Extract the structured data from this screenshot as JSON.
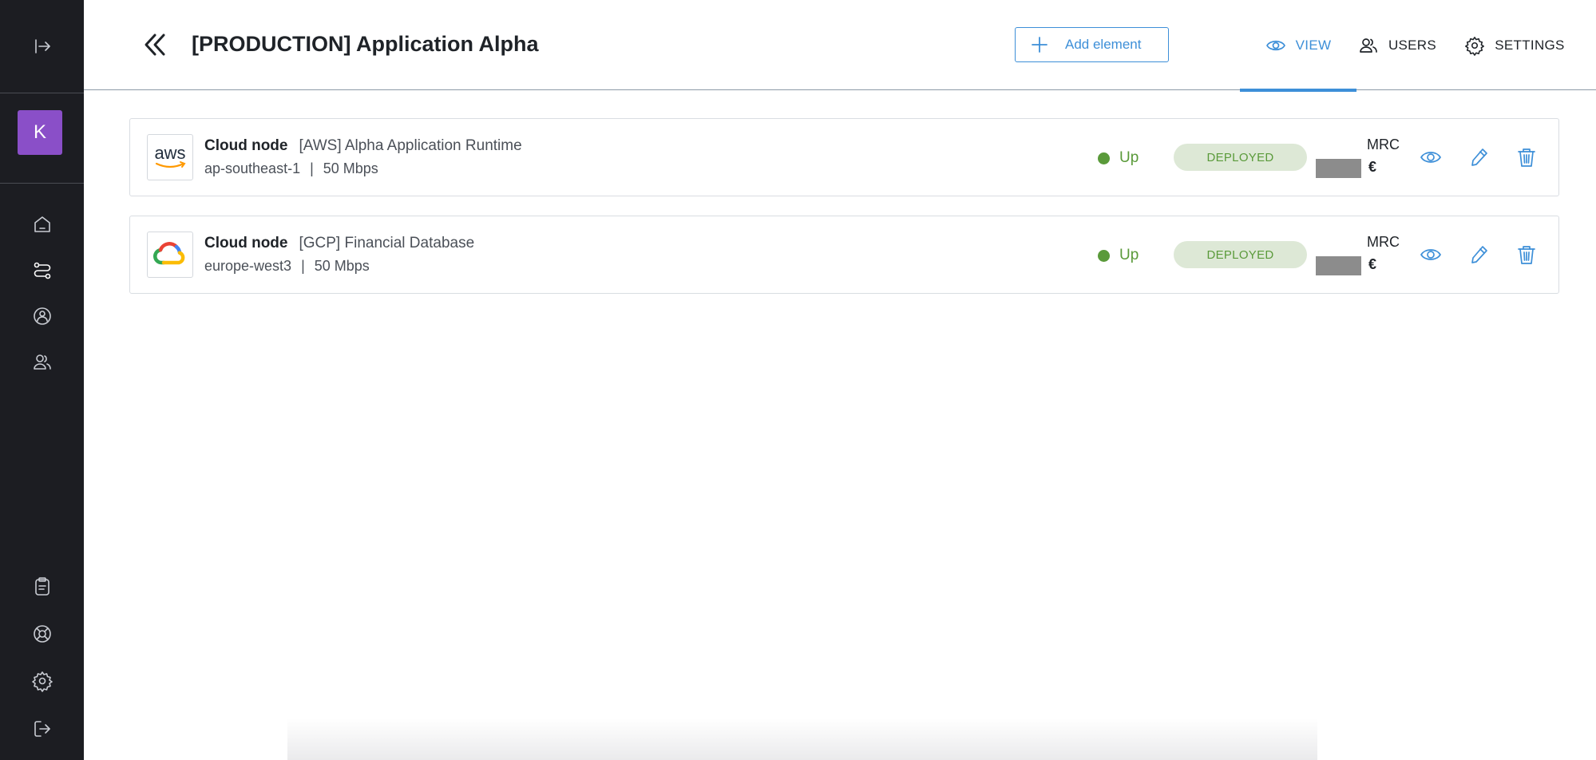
{
  "sidebar": {
    "avatar_letter": "K",
    "top_icons": [
      {
        "icon": "collapse-expand-icon"
      }
    ],
    "nav_icons": [
      {
        "icon": "home-icon"
      },
      {
        "icon": "connections-icon"
      },
      {
        "icon": "network-circle-icon"
      },
      {
        "icon": "users-icon"
      }
    ],
    "bottom_icons": [
      {
        "icon": "clipboard-icon"
      },
      {
        "icon": "support-lifebuoy-icon"
      },
      {
        "icon": "gear-icon"
      },
      {
        "icon": "logout-icon"
      }
    ]
  },
  "header": {
    "title": "[PRODUCTION] Application Alpha",
    "add_button_label": "Add element",
    "tabs": [
      {
        "label": "VIEW",
        "icon": "eye-icon",
        "active": true
      },
      {
        "label": "USERS",
        "icon": "users-icon",
        "active": false
      },
      {
        "label": "SETTINGS",
        "icon": "gear-icon",
        "active": false
      }
    ]
  },
  "nodes": [
    {
      "kind": "Cloud node",
      "name": "[AWS] Alpha Application Runtime",
      "region": "ap-southeast-1",
      "separator": "|",
      "bandwidth": "50 Mbps",
      "status": "Up",
      "state": "DEPLOYED",
      "mrc_label": "MRC",
      "currency": "€",
      "logo": "aws-logo"
    },
    {
      "kind": "Cloud node",
      "name": "[GCP] Financial Database",
      "region": "europe-west3",
      "separator": "|",
      "bandwidth": "50 Mbps",
      "status": "Up",
      "state": "DEPLOYED",
      "mrc_label": "MRC",
      "currency": "€",
      "logo": "google-cloud-logo"
    }
  ],
  "colors": {
    "accent": "#3d8fd8",
    "sidebar_bg": "#1c1d22",
    "avatar_bg": "#8a4fc8",
    "status_green": "#5a9a3a",
    "badge_bg": "#dde8d6"
  }
}
